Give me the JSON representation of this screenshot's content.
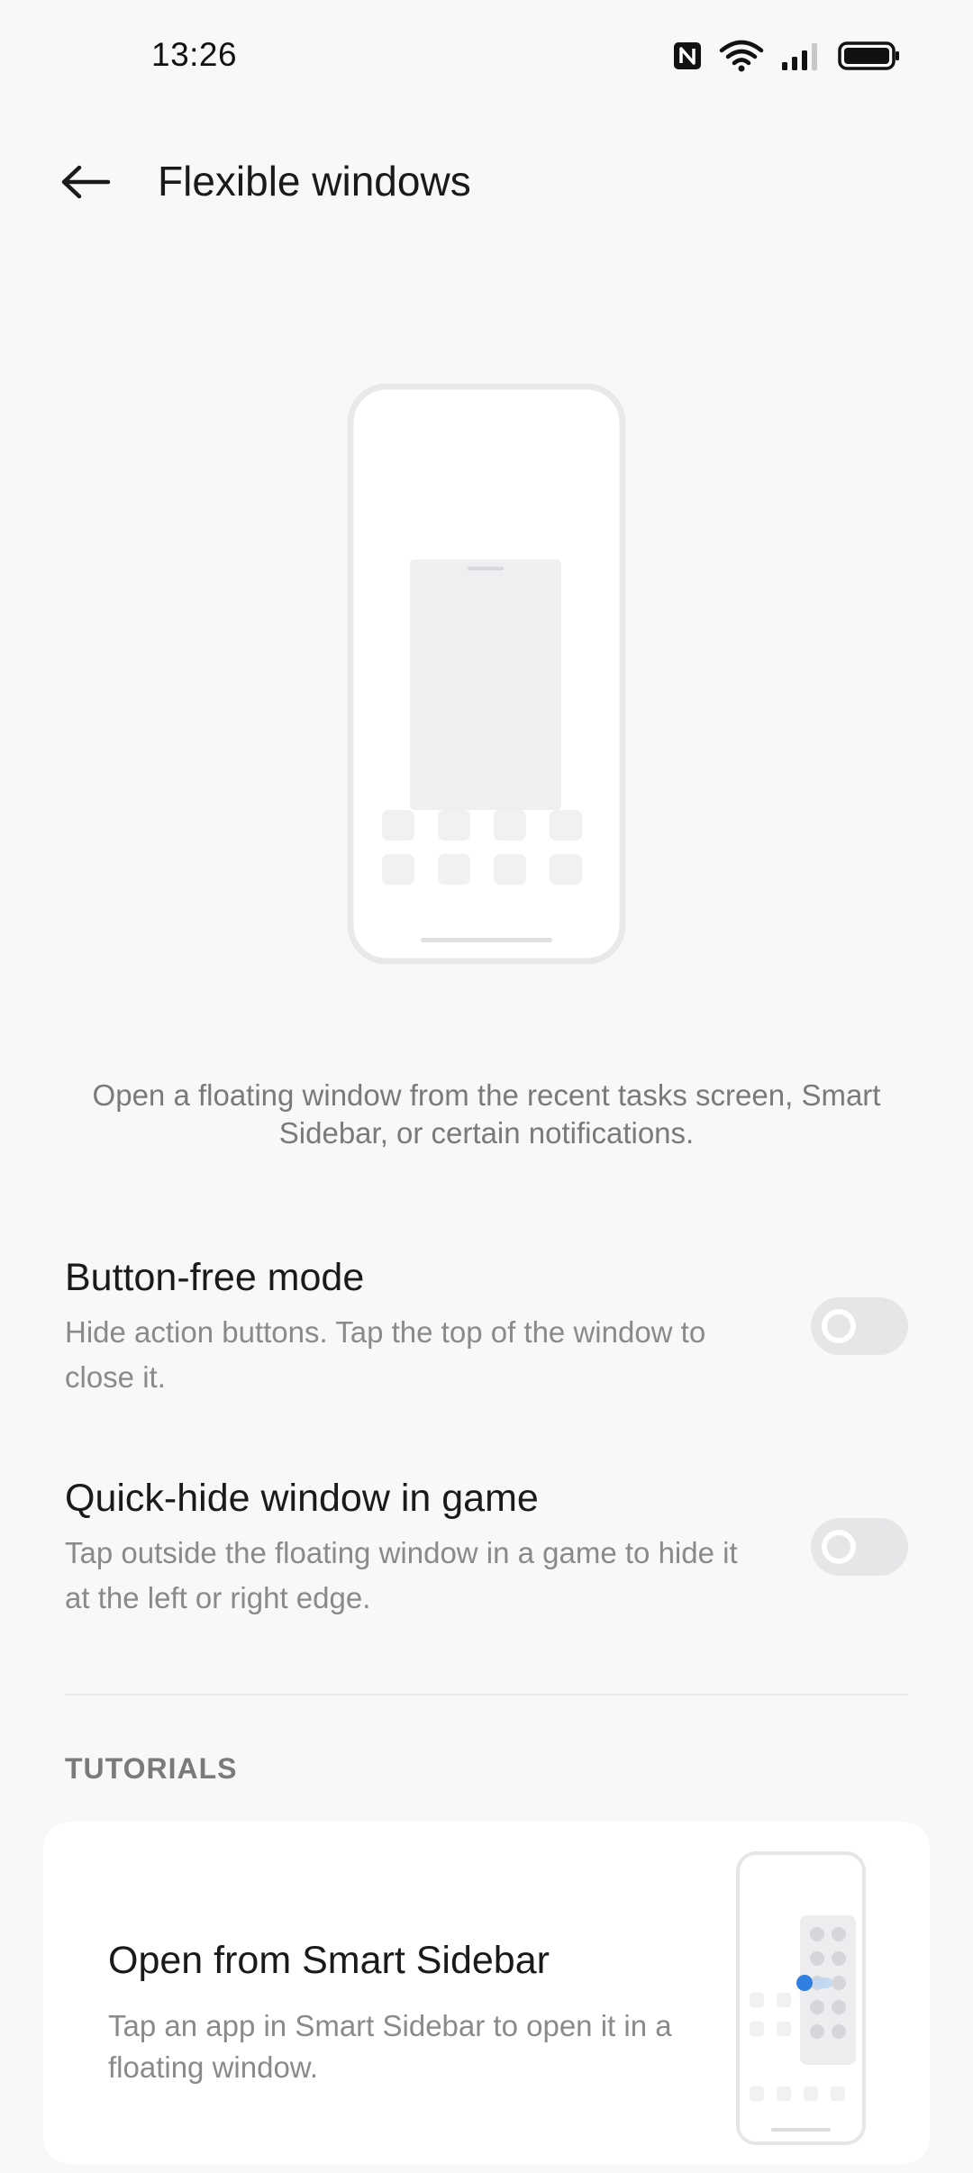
{
  "status_bar": {
    "time": "13:26",
    "icons": [
      "nfc-icon",
      "wifi-icon",
      "signal-icon",
      "battery-icon"
    ]
  },
  "header": {
    "back_icon": "arrow-left-icon",
    "title": "Flexible windows"
  },
  "description": "Open a floating window from the recent tasks screen, Smart Sidebar, or certain notifications.",
  "settings": [
    {
      "title": "Button-free mode",
      "subtitle": "Hide action buttons. Tap the top of the window to close it.",
      "enabled": false
    },
    {
      "title": "Quick-hide window in game",
      "subtitle": "Tap outside the floating window in a game to hide it at the left or right edge.",
      "enabled": false
    }
  ],
  "tutorials": {
    "section_label": "TUTORIALS",
    "items": [
      {
        "title": "Open from Smart Sidebar",
        "description": "Tap an app in Smart Sidebar to open it in a floating window."
      }
    ]
  },
  "colors": {
    "background": "#f8f8f9",
    "accent": "#2f7fe0",
    "toggle_off": "#e6e6e8"
  }
}
